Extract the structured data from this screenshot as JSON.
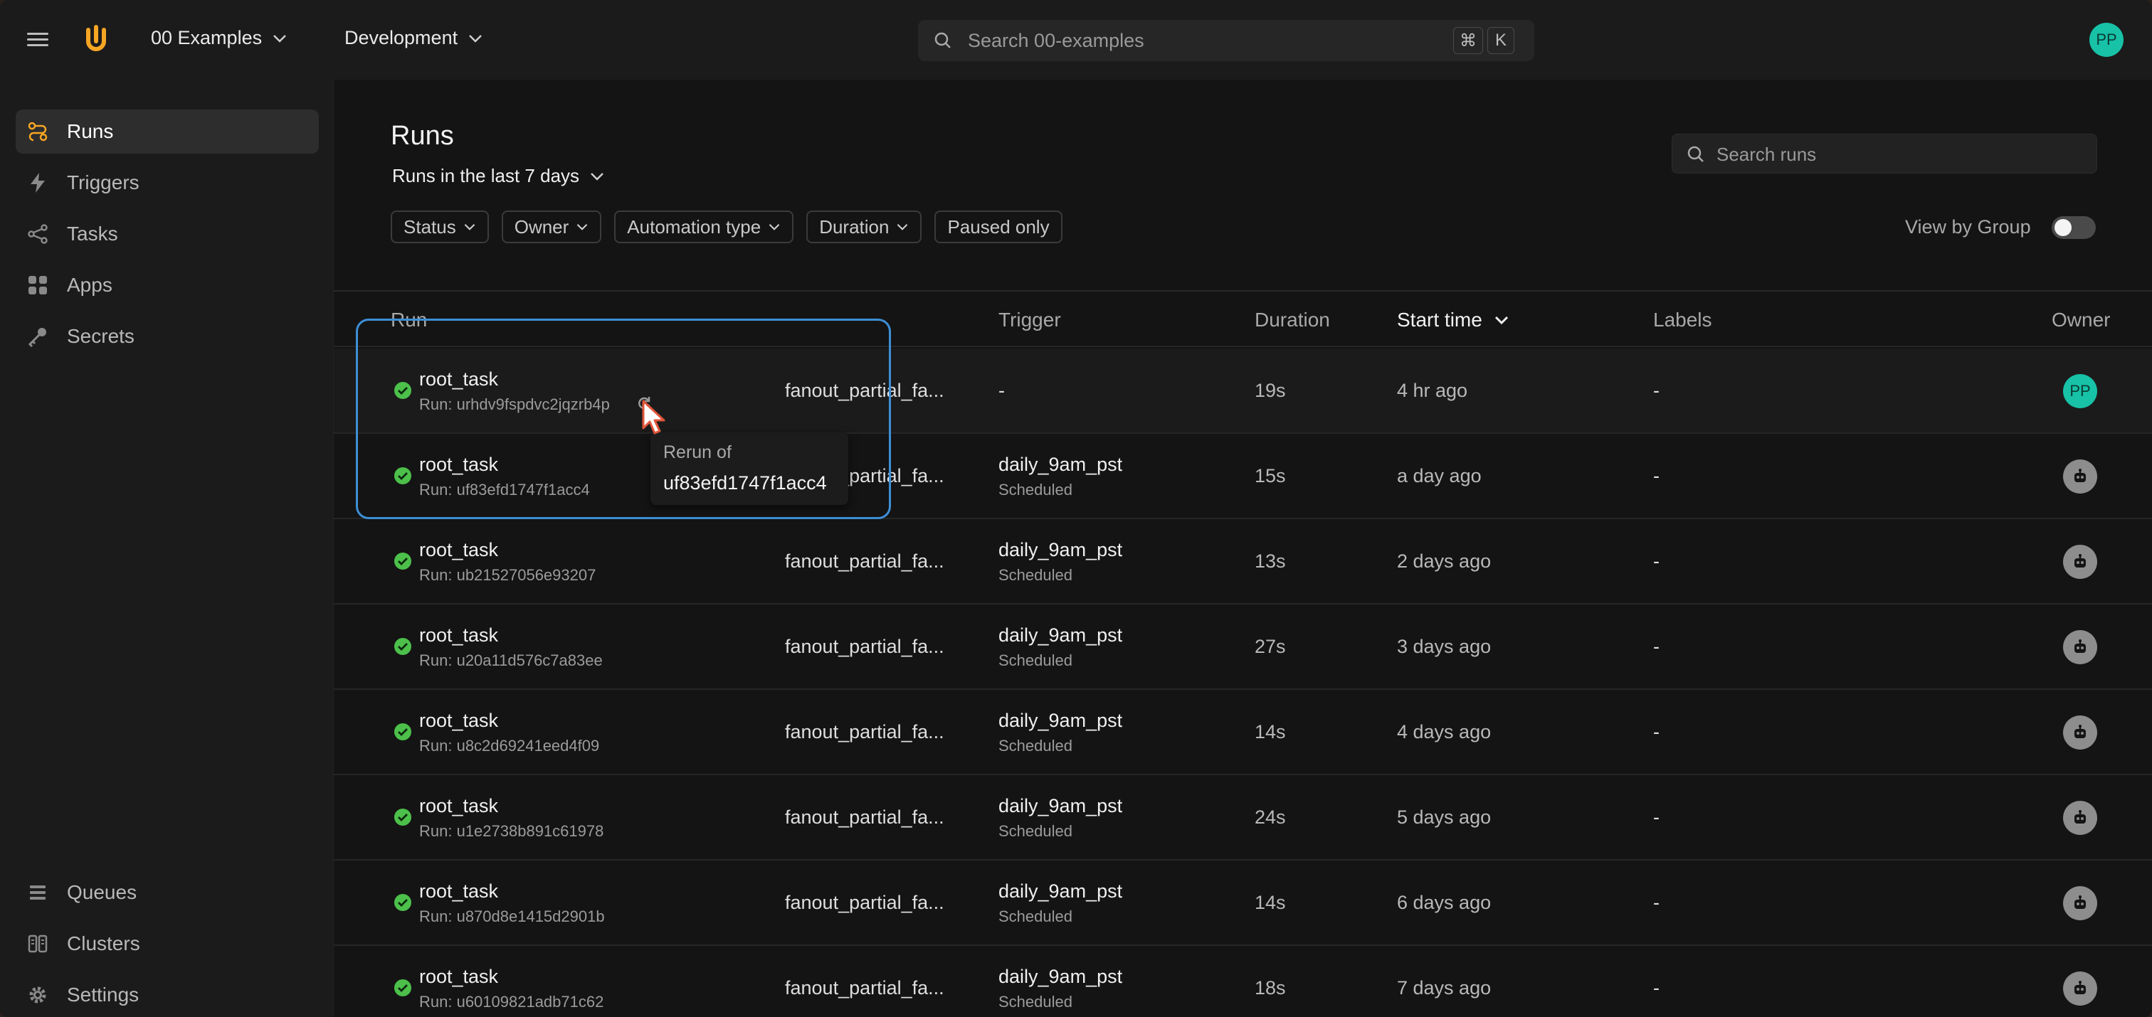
{
  "topbar": {
    "workspace": "00 Examples",
    "environment": "Development",
    "search_placeholder": "Search 00-examples",
    "shortcut_cmd": "⌘",
    "shortcut_key": "K",
    "user_initials": "PP"
  },
  "sidebar": {
    "items": [
      {
        "label": "Runs",
        "icon": "runs-icon",
        "active": true
      },
      {
        "label": "Triggers",
        "icon": "bolt-icon"
      },
      {
        "label": "Tasks",
        "icon": "share-icon"
      },
      {
        "label": "Apps",
        "icon": "apps-icon"
      },
      {
        "label": "Secrets",
        "icon": "key-icon"
      }
    ],
    "bottom_items": [
      {
        "label": "Queues",
        "icon": "queue-icon"
      },
      {
        "label": "Clusters",
        "icon": "cluster-icon"
      },
      {
        "label": "Settings",
        "icon": "gear-icon"
      }
    ]
  },
  "main": {
    "title": "Runs",
    "range": "Runs in the last 7 days",
    "filters": [
      "Status",
      "Owner",
      "Automation type",
      "Duration",
      "Paused only"
    ],
    "search_placeholder": "Search runs",
    "view_by_group": "View by Group",
    "columns": {
      "run": "Run",
      "trigger": "Trigger",
      "duration": "Duration",
      "start_time": "Start time",
      "labels": "Labels",
      "owner": "Owner"
    },
    "rows": [
      {
        "task": "root_task",
        "run": "Run: urhdv9fspdvc2jqzrb4p",
        "app": "fanout_partial_fa...",
        "trigger": "-",
        "trigger_sub": "",
        "duration": "19s",
        "start": "4 hr ago",
        "labels": "-",
        "owner": "PP"
      },
      {
        "task": "root_task",
        "run": "Run: uf83efd1747f1acc4",
        "app": "fanout_partial_fa...",
        "trigger": "daily_9am_pst",
        "trigger_sub": "Scheduled",
        "duration": "15s",
        "start": "a day ago",
        "labels": "-",
        "owner": "bot"
      },
      {
        "task": "root_task",
        "run": "Run: ub21527056e93207",
        "app": "fanout_partial_fa...",
        "trigger": "daily_9am_pst",
        "trigger_sub": "Scheduled",
        "duration": "13s",
        "start": "2 days ago",
        "labels": "-",
        "owner": "bot"
      },
      {
        "task": "root_task",
        "run": "Run: u20a11d576c7a83ee",
        "app": "fanout_partial_fa...",
        "trigger": "daily_9am_pst",
        "trigger_sub": "Scheduled",
        "duration": "27s",
        "start": "3 days ago",
        "labels": "-",
        "owner": "bot"
      },
      {
        "task": "root_task",
        "run": "Run: u8c2d69241eed4f09",
        "app": "fanout_partial_fa...",
        "trigger": "daily_9am_pst",
        "trigger_sub": "Scheduled",
        "duration": "14s",
        "start": "4 days ago",
        "labels": "-",
        "owner": "bot"
      },
      {
        "task": "root_task",
        "run": "Run: u1e2738b891c61978",
        "app": "fanout_partial_fa...",
        "trigger": "daily_9am_pst",
        "trigger_sub": "Scheduled",
        "duration": "24s",
        "start": "5 days ago",
        "labels": "-",
        "owner": "bot"
      },
      {
        "task": "root_task",
        "run": "Run: u870d8e1415d2901b",
        "app": "fanout_partial_fa...",
        "trigger": "daily_9am_pst",
        "trigger_sub": "Scheduled",
        "duration": "14s",
        "start": "6 days ago",
        "labels": "-",
        "owner": "bot"
      },
      {
        "task": "root_task",
        "run": "Run: u60109821adb71c62",
        "app": "fanout_partial_fa...",
        "trigger": "daily_9am_pst",
        "trigger_sub": "Scheduled",
        "duration": "18s",
        "start": "7 days ago",
        "labels": "-",
        "owner": "bot"
      }
    ],
    "tooltip": {
      "title": "Rerun of",
      "value": "uf83efd1747f1acc4"
    }
  },
  "colors": {
    "accent": "#f5a623",
    "success": "#4cc04a",
    "highlight": "#3d8fd6",
    "avatar": "#17c2a7"
  }
}
